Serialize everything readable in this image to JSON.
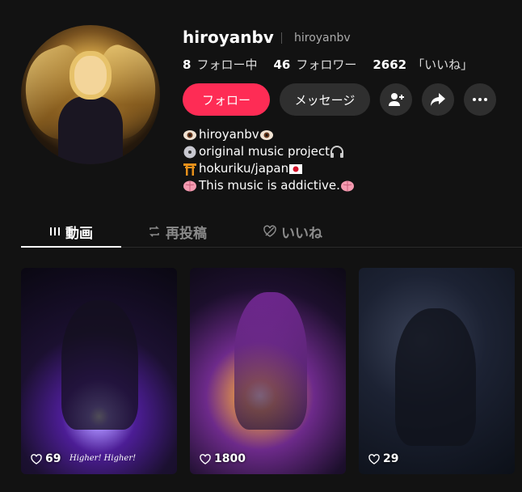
{
  "profile": {
    "username": "hiroyanbv",
    "handle": "hiroyanbv",
    "stats": [
      {
        "value": "8",
        "label": "フォロー中"
      },
      {
        "value": "46",
        "label": "フォロワー"
      },
      {
        "value": "2662",
        "label": "「いいね」"
      }
    ],
    "follow_label": "フォロー",
    "message_label": "メッセージ",
    "bio": [
      "hiroyanbv",
      "original music project",
      "hokuriku/japan",
      "This music is addictive."
    ]
  },
  "tabs": [
    {
      "label": "動画",
      "icon": "grid-icon",
      "active": true
    },
    {
      "label": "再投稿",
      "icon": "repost-icon",
      "active": false
    },
    {
      "label": "いいね",
      "icon": "heart-hidden-icon",
      "active": false
    }
  ],
  "videos": [
    {
      "views": "69",
      "caption": "Higher! Higher!"
    },
    {
      "views": "1800",
      "caption": ""
    },
    {
      "views": "29",
      "caption": ""
    }
  ],
  "colors": {
    "accent": "#fe2c55",
    "background": "#121212"
  }
}
